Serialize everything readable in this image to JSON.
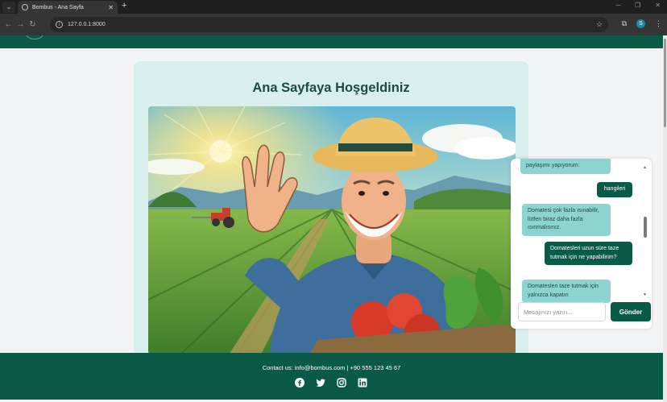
{
  "browser": {
    "tab_title": "Bombus - Ana Sayfa",
    "tab_close": "✕",
    "new_tab": "+",
    "url": "127.0.0.1:8000",
    "profile_initial": "S"
  },
  "page": {
    "heading": "Ana Sayfaya Hoşgeldiniz",
    "hero_image": "farmer-waving-in-field"
  },
  "footer": {
    "contact": "Contact us: info@bombus.com | +90 555 123 45 67",
    "socials": [
      "facebook-icon",
      "twitter-icon",
      "instagram-icon",
      "linkedin-icon"
    ]
  },
  "chat": {
    "messages": [
      {
        "role": "bot",
        "text": "paylaşımı yapıyorum:"
      },
      {
        "role": "user",
        "text": "hangileri"
      },
      {
        "role": "bot",
        "text": "Domatesi çok fazla ısınabilir, lütfen biraz daha fazla ısınmalısınız."
      },
      {
        "role": "user",
        "text": "Domatesleri uzun süre taze tutmak için ne yapabilirim?"
      },
      {
        "role": "bot",
        "text": "Domatesleri taze tutmak için yalnızca kapatın"
      }
    ],
    "input_placeholder": "Mesajınızı yazın...",
    "send_label": "Gönder"
  },
  "colors": {
    "brand_green": "#0b5a48",
    "card_bg": "#d8efed",
    "bot_bubble": "#8dd3cf"
  }
}
